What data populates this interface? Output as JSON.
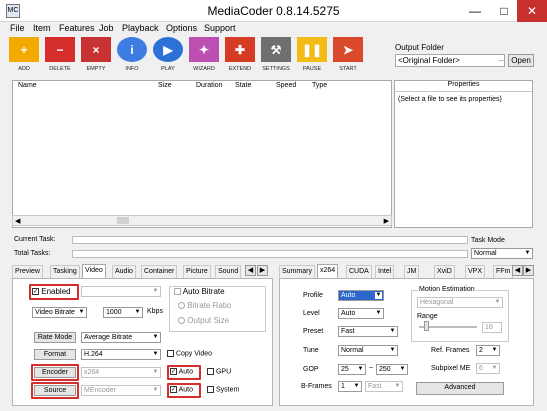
{
  "window": {
    "title": "MediaCoder 0.8.14.5275",
    "minimize": "—",
    "maximize": "□",
    "close": "✕",
    "icon_text": "MC"
  },
  "menu": [
    "File",
    "Item",
    "Features",
    "Job",
    "Playback",
    "Options",
    "Support"
  ],
  "toolbar": [
    {
      "label": "ADD",
      "icon": "plus-icon",
      "color": "#f2a900",
      "glyph": "+"
    },
    {
      "label": "DELETE",
      "icon": "minus-icon",
      "color": "#d62d2d",
      "glyph": "−"
    },
    {
      "label": "EMPTY",
      "icon": "empty-icon",
      "color": "#c83232",
      "glyph": "×"
    },
    {
      "label": "INFO",
      "icon": "info-icon",
      "color": "#3d7ce2",
      "glyph": "i"
    },
    {
      "label": "PLAY",
      "icon": "play-icon",
      "color": "#2b71d6",
      "glyph": "▶"
    },
    {
      "label": "WIZARD",
      "icon": "wizard-icon",
      "color": "#be4fb2",
      "glyph": "✦"
    },
    {
      "label": "EXTEND",
      "icon": "puzzle-icon",
      "color": "#d53b25",
      "glyph": "✚"
    },
    {
      "label": "SETTINGS",
      "icon": "wrench-icon",
      "color": "#6f6f6f",
      "glyph": "⚒"
    },
    {
      "label": "PAUSE",
      "icon": "pause-icon",
      "color": "#f4bb16",
      "glyph": "❚❚"
    },
    {
      "label": "START",
      "icon": "start-icon",
      "color": "#da492c",
      "glyph": "➤"
    }
  ],
  "output": {
    "label": "Output Folder",
    "value": "<Original Folder>",
    "browse": "...",
    "open": "Open"
  },
  "task_columns": [
    "Name",
    "Size",
    "Duration",
    "State",
    "Speed",
    "Type"
  ],
  "properties": {
    "title": "Properties",
    "hint": "(Select a file to see its properties)"
  },
  "progress": {
    "current_task": "Current Task:",
    "total_tasks": "Total Tasks:"
  },
  "task_mode": {
    "label": "Task Mode",
    "value": "Normal"
  },
  "left_tabs": [
    "Preview",
    "Tasking",
    "Video",
    "Audio",
    "Container",
    "Picture",
    "Sound"
  ],
  "left_nav": {
    "prev": "◀",
    "next": "▶"
  },
  "video": {
    "enabled_label": "Enabled",
    "enabled_value": "",
    "bitrate_mode": "Video Bitrate",
    "bitrate_value": "1000",
    "bitrate_unit": "Kbps",
    "rate_mode_button": "Rate Mode",
    "rate_mode_value": "Average Bitrate",
    "format_button": "Format",
    "format_value": "H.264",
    "encoder_button": "Encoder",
    "encoder_value": "x264",
    "source_button": "Source",
    "source_value": "MEncoder",
    "auto_bitrate": "Auto Bitrate",
    "bitrate_ratio": "Bitrate Ratio",
    "output_size": "Output Size",
    "copy_video": "Copy Video",
    "auto": "Auto",
    "gpu": "GPU",
    "system": "System"
  },
  "right_tabs": [
    "Summary",
    "x264",
    "CUDA",
    "Intel",
    "JM",
    "XviD",
    "VPX",
    "FFm"
  ],
  "right_nav": {
    "prev": "◀",
    "next": "▶"
  },
  "x264": {
    "profile_label": "Profile",
    "profile_value": "Auto",
    "level_label": "Level",
    "level_value": "Auto",
    "preset_label": "Preset",
    "preset_value": "Fast",
    "tune_label": "Tune",
    "tune_value": "Normal",
    "gop_label": "GOP",
    "gop_min": "25",
    "gop_sep": "~",
    "gop_max": "250",
    "bframes_label": "B-Frames",
    "bframes_value": "1",
    "bframes_mode": "Fast",
    "motion_group": "Motion Estimation",
    "motion_value": "Hexagonal",
    "range_label": "Range",
    "range_value": "16",
    "ref_frames_label": "Ref. Frames",
    "ref_frames_value": "2",
    "subpixel_label": "Subpixel ME",
    "subpixel_value": "6",
    "advanced": "Advanced"
  }
}
